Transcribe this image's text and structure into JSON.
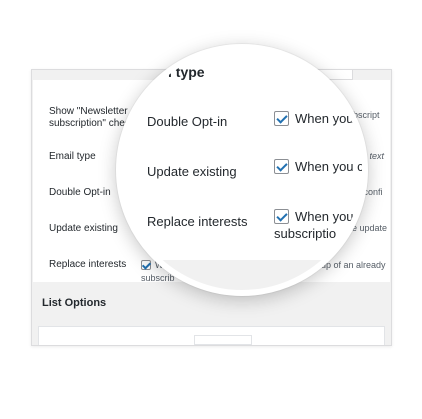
{
  "form": {
    "rows": [
      {
        "label_line1": "Show \"Newsletter",
        "label_line2": "subscription\" checked",
        "desc": "er subscript"
      },
      {
        "label": "Email type",
        "desc": "lain text"
      },
      {
        "label": "Double Opt-in",
        "desc": "a confi"
      },
      {
        "label": "Update existing",
        "desc": "e update"
      },
      {
        "label": "Replace interests",
        "check_text": "W",
        "desc": "up of an already",
        "sub_text": "subscrib"
      }
    ]
  },
  "list_options": {
    "title": "List Options"
  },
  "lens": {
    "title": "l type",
    "rows": [
      {
        "label": "Double Opt-in",
        "text": "When you"
      },
      {
        "label": "Update existing",
        "text": "When you c"
      },
      {
        "label": "Replace interests",
        "text": "When you",
        "sub": "subscriptio"
      }
    ]
  }
}
